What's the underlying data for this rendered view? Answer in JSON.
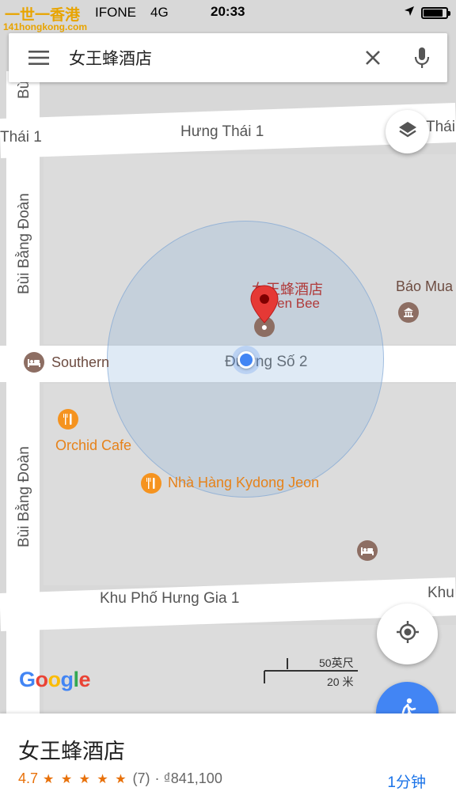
{
  "status_bar": {
    "logo_text": "一世一香港",
    "logo_sub": "141hongkong.com",
    "carrier": "IFONE",
    "network": "4G",
    "time": "20:33"
  },
  "search": {
    "query": "女王蜂酒店",
    "menu_icon": "menu-icon",
    "clear_icon": "close-icon",
    "mic_icon": "microphone-icon"
  },
  "map": {
    "roads": {
      "hung_thai_1": "Hưng Thái 1",
      "thai_1_left": "Thái 1",
      "thai_right": "Thái",
      "bui_bang_doan": "Bùi Bằng Đoàn",
      "duong_so_2": "Đường Số 2",
      "khu_pho_hung_gia_1": "Khu Phố Hưng Gia 1",
      "khu_right": "Khu",
      "bui_top": "Bùi"
    },
    "pois": {
      "queen_bee_cn": "女王蜂酒店",
      "queen_bee_en": "Queen Bee",
      "bao_mua": "Báo Mua",
      "southern": "Southern",
      "orchid_cafe": "Orchid Cafe",
      "kydong": "Nhà Hàng Kydong Jeon"
    },
    "scale": {
      "imperial": "50英尺",
      "metric": "20 米"
    },
    "brand": "Google",
    "brand_colors": [
      "#4285f4",
      "#ea4335",
      "#fbbc05",
      "#4285f4",
      "#34a853",
      "#ea4335"
    ]
  },
  "place": {
    "name": "女王蜂酒店",
    "rating": "4.7",
    "stars": "★ ★ ★ ★ ★",
    "review_count": "(7)",
    "price": "· ₫841,100",
    "travel_time": "1分钟"
  },
  "colors": {
    "accent": "#4285f4",
    "pin": "#e53935",
    "rating": "#e8710a",
    "link": "#1a73e8"
  }
}
